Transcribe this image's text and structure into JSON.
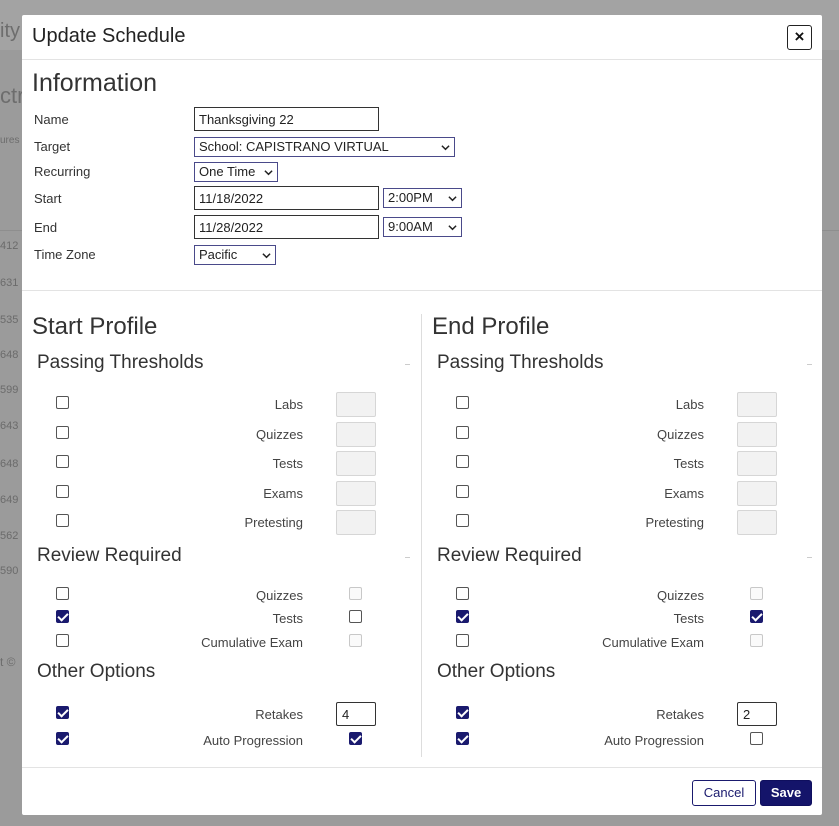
{
  "modal": {
    "title": "Update Schedule",
    "close_label": "×"
  },
  "information": {
    "heading": "Information",
    "fields": {
      "name_label": "Name",
      "name_value": "Thanksgiving 22",
      "target_label": "Target",
      "target_value": "School: CAPISTRANO VIRTUAL",
      "recurring_label": "Recurring",
      "recurring_value": "One Time",
      "start_label": "Start",
      "start_date": "11/18/2022",
      "start_time": "2:00PM",
      "end_label": "End",
      "end_date": "11/28/2022",
      "end_time": "9:00AM",
      "timezone_label": "Time Zone",
      "timezone_value": "Pacific"
    }
  },
  "start_profile": {
    "heading": "Start Profile",
    "passing_thresholds": {
      "heading": "Passing Thresholds",
      "rows": [
        {
          "label": "Labs",
          "checked": false
        },
        {
          "label": "Quizzes",
          "checked": false
        },
        {
          "label": "Tests",
          "checked": false
        },
        {
          "label": "Exams",
          "checked": false
        },
        {
          "label": "Pretesting",
          "checked": false
        }
      ]
    },
    "review_required": {
      "heading": "Review Required",
      "rows": [
        {
          "label": "Quizzes",
          "checked": false,
          "right_checked": false,
          "right_enabled": false
        },
        {
          "label": "Tests",
          "checked": true,
          "right_checked": false,
          "right_enabled": true
        },
        {
          "label": "Cumulative Exam",
          "checked": false,
          "right_checked": false,
          "right_enabled": false
        }
      ]
    },
    "other_options": {
      "heading": "Other Options",
      "retakes_label": "Retakes",
      "retakes_checked": true,
      "retakes_value": "4",
      "auto_label": "Auto Progression",
      "auto_checked": true,
      "auto_right_checked": true
    }
  },
  "end_profile": {
    "heading": "End Profile",
    "passing_thresholds": {
      "heading": "Passing Thresholds",
      "rows": [
        {
          "label": "Labs",
          "checked": false
        },
        {
          "label": "Quizzes",
          "checked": false
        },
        {
          "label": "Tests",
          "checked": false
        },
        {
          "label": "Exams",
          "checked": false
        },
        {
          "label": "Pretesting",
          "checked": false
        }
      ]
    },
    "review_required": {
      "heading": "Review Required",
      "rows": [
        {
          "label": "Quizzes",
          "checked": false,
          "right_checked": false,
          "right_enabled": false
        },
        {
          "label": "Tests",
          "checked": true,
          "right_checked": true,
          "right_enabled": true
        },
        {
          "label": "Cumulative Exam",
          "checked": false,
          "right_checked": false,
          "right_enabled": false
        }
      ]
    },
    "other_options": {
      "heading": "Other Options",
      "retakes_label": "Retakes",
      "retakes_checked": true,
      "retakes_value": "2",
      "auto_label": "Auto Progression",
      "auto_checked": true,
      "auto_right_checked": false
    }
  },
  "footer": {
    "cancel_label": "Cancel",
    "save_label": "Save"
  },
  "background": {
    "fragments": [
      "ity",
      "ctri",
      "ures",
      "412",
      "631",
      "535",
      "648",
      "599",
      "643",
      "648",
      "649",
      "562",
      "590",
      "t ©"
    ]
  },
  "colors": {
    "accent": "#14146a",
    "overlay": "#9b9b9b"
  }
}
